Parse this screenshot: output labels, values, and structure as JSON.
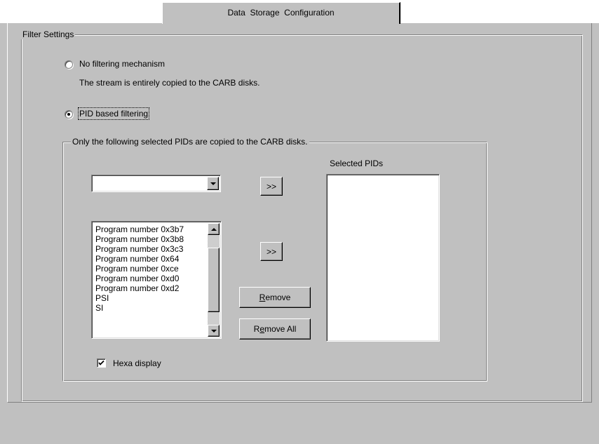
{
  "tab": {
    "label": "Data  Storage  Configuration"
  },
  "filter_settings": {
    "legend": "Filter Settings",
    "no_filter": {
      "label": "No filtering mechanism",
      "selected": false
    },
    "no_filter_description": "The stream is entirely copied to the CARB disks.",
    "pid_filter": {
      "label": "PID based filtering",
      "selected": true
    }
  },
  "pid_group": {
    "legend": "Only the following selected PIDs are copied to the CARB disks.",
    "dropdown": {
      "value": ""
    },
    "add_button_1": ">>",
    "add_button_2": ">>",
    "remove_button": {
      "mnemonic": "R",
      "rest": "emove"
    },
    "remove_all_button": {
      "mnemonic": "e",
      "prefix": "R",
      "rest": "move All"
    },
    "selected_pids_label": "Selected PIDs",
    "selected_pids": [],
    "pid_list": [
      "Program number 0x3b7",
      "Program number 0x3b8",
      "Program number 0x3c3",
      "Program number 0x64",
      "Program number 0xce",
      "Program number 0xd0",
      "Program number 0xd2",
      "PSI",
      "SI"
    ],
    "hexa_display": {
      "label": "Hexa display",
      "checked": true
    }
  }
}
